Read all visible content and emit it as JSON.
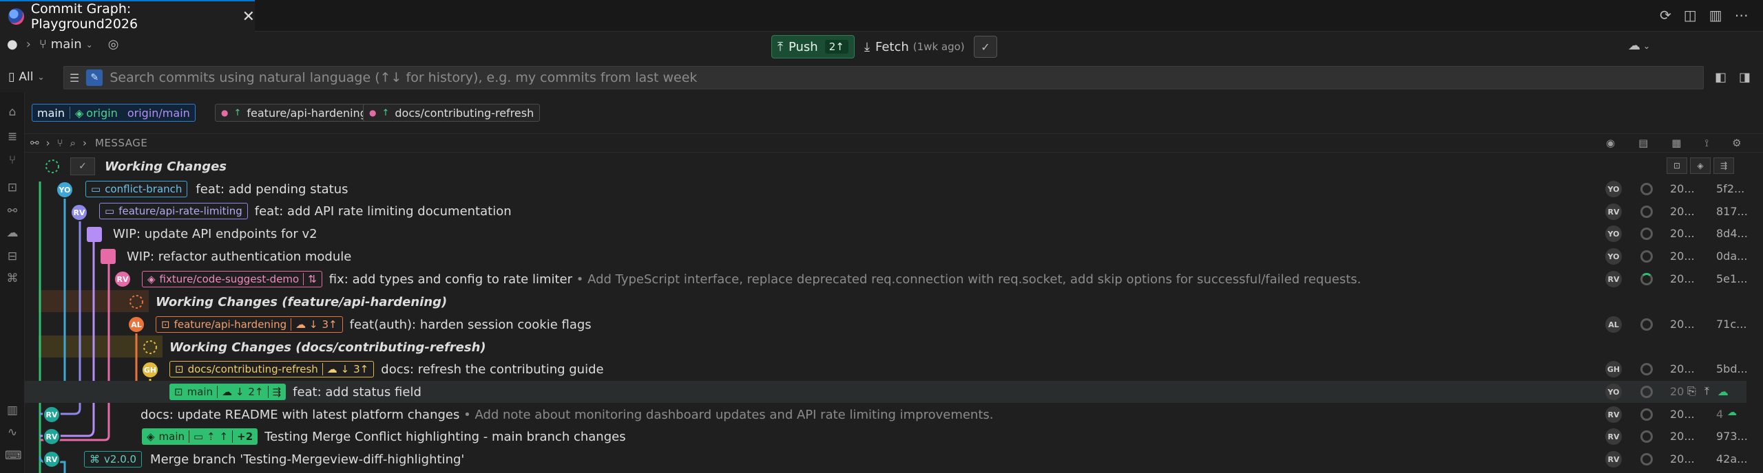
{
  "tab": {
    "title": "Commit Graph: Playground2026",
    "close": "✕"
  },
  "toolbar": {
    "branch": "main",
    "push_label": "Push",
    "push_count": "2↑",
    "fetch_label": "Fetch",
    "fetch_sub": "(1wk ago)"
  },
  "search": {
    "scope": "All",
    "placeholder": "Search commits using natural language (↑↓ for history), e.g. my commits from last week"
  },
  "chips": {
    "main": "main",
    "origin": "origin",
    "origin_main": "origin/main",
    "api": "feature/api-hardening",
    "docs": "docs/contributing-refresh"
  },
  "header": {
    "message": "MESSAGE"
  },
  "rows": [
    {
      "type": "wc",
      "message": "Working Changes"
    },
    {
      "author": "YO",
      "tag": "conflict-branch",
      "message": "feat: add pending status",
      "date": "20...",
      "sha": "5f2..."
    },
    {
      "author": "RV",
      "tag": "feature/api-rate-limiting",
      "message": "feat: add API rate limiting documentation",
      "date": "20...",
      "sha": "817..."
    },
    {
      "author": "YO",
      "message": "WIP: update API endpoints for v2",
      "date": "20...",
      "sha": "8d4..."
    },
    {
      "author": "YO",
      "message": "WIP: refactor authentication module",
      "date": "20...",
      "sha": "0da..."
    },
    {
      "author": "RV",
      "tag": "fixture/code-suggest-demo",
      "message": "fix: add types and config to rate limiter",
      "desc": " • Add TypeScript interface, replace deprecated req.connection with req.socket, add skip options for successful/failed requests.",
      "date": "20...",
      "sha": "5e1..."
    },
    {
      "type": "wc",
      "message": "Working Changes (feature/api-hardening)"
    },
    {
      "author": "AL",
      "tag": "feature/api-hardening",
      "tag_count": "3↑",
      "message": "feat(auth): harden session cookie flags",
      "date": "20...",
      "sha": "71c..."
    },
    {
      "type": "wc",
      "message": "Working Changes (docs/contributing-refresh)"
    },
    {
      "author": "GH",
      "tag": "docs/contributing-refresh",
      "tag_count": "3↑",
      "message": "docs: refresh the contributing guide",
      "date": "20...",
      "sha": "5bd..."
    },
    {
      "author": "YO",
      "tag": "main",
      "tag_count": "2↑",
      "message": "feat: add status field",
      "date": "20",
      "sha": ""
    },
    {
      "author": "RV",
      "message": "docs: update README with latest platform changes",
      "desc": " • Add note about monitoring dashboard updates and API rate limiting improvements.",
      "date": "20...",
      "sha": "4"
    },
    {
      "author": "RV",
      "tag": "main",
      "tag_count": "↑",
      "tag_extra": "+2",
      "message": "Testing Merge Conflict highlighting - main branch changes",
      "date": "20...",
      "sha": "973..."
    },
    {
      "author": "RV",
      "tag": "v2.0.0",
      "message": "Merge branch 'Testing-Mergeview-diff-highlighting'",
      "date": "20...",
      "sha": "42a..."
    }
  ],
  "colors": {
    "yellow_lane": "#e2b93d",
    "blue_lane": "#3fa7d6",
    "purple_lane": "#8e88e8",
    "pink_lane": "#e56ba7",
    "orange_lane": "#e8743b",
    "green_lane": "#2fbf71"
  }
}
